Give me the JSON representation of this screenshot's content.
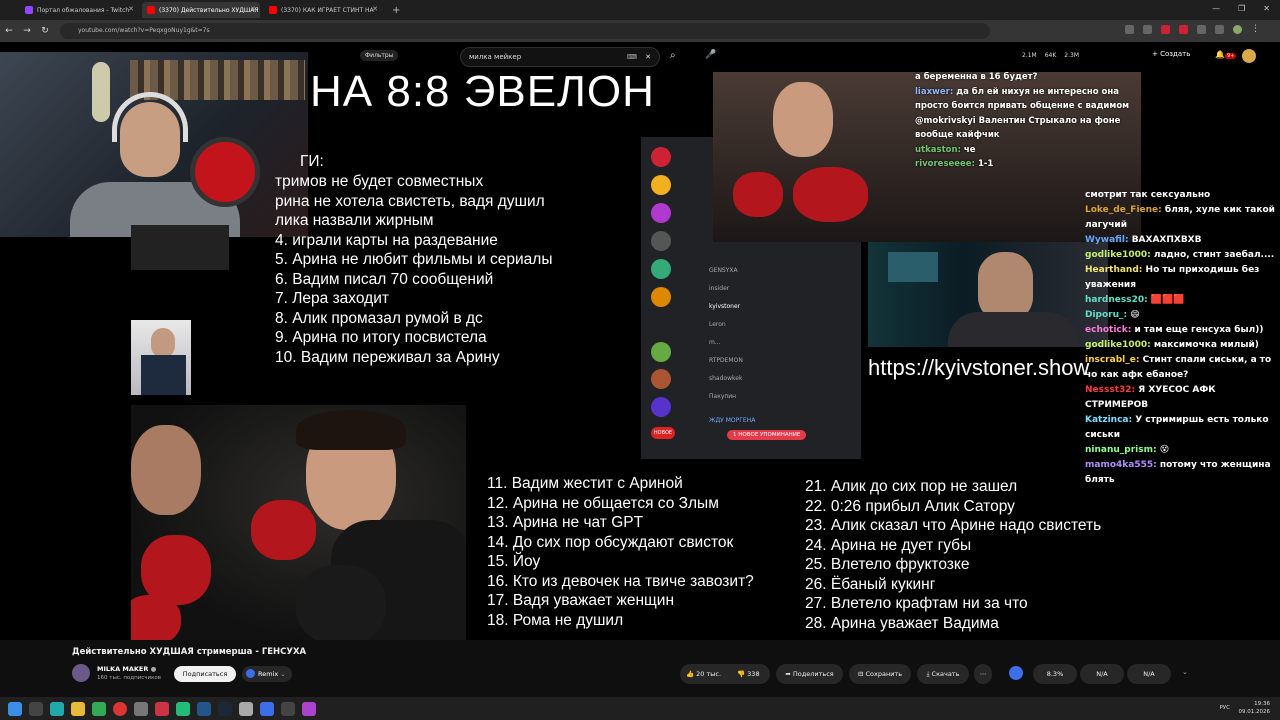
{
  "browser": {
    "tabs": [
      {
        "label": "Портал обжалования - Twitch",
        "color": "#9146ff",
        "active": false
      },
      {
        "label": "(3370) Действительно ХУДШАЯ",
        "color": "#ff0000",
        "active": true
      },
      {
        "label": "(3370) КАК ИГРАЕТ СТИНТ НА",
        "color": "#ff0000",
        "active": false
      }
    ],
    "url": "youtube.com/watch?v=PeqxgoNuy1g&t=7s"
  },
  "youtube_overlay": {
    "filter_label": "Фильтры",
    "search_value": "милка мейкер",
    "create_label": "Создать",
    "notif_badge": "9+",
    "top_stats": [
      "2.1M",
      "64K",
      "2.3M"
    ]
  },
  "video": {
    "headline": "НА 8:8 ЭВЕЛОН",
    "list_header": "ГИ:",
    "list_col1": [
      "тримов не будет совместных",
      "рина не хотела свистеть, вадя душил",
      "лика назвали жирным",
      "4. играли карты на раздевание",
      "5. Арина не любит фильмы и сериалы",
      "6. Вадим писал 70 сообщений",
      "7. Лера заходит",
      "8. Алик промазал румой в дс",
      "9. Арина по итогу посвистела",
      "10. Вадим переживал за Арину"
    ],
    "list_col2": [
      "11. Вадим жестит с Ариной",
      "12. Арина не общается со Злым",
      "13. Арина не чат GPT",
      "14. До сих пор обсуждают свисток",
      "15. Йоу",
      "16. Кто из девочек на твиче завозит?",
      "17. Вадя уважает женщин",
      "18. Рома не душил"
    ],
    "list_col3": [
      "21. Алик до сих пор не зашел",
      "22. 0:26 прибыл Алик Сатору",
      "23. Алик сказал что Арине надо свистеть",
      "24. Арина не дует губы",
      "25. Влетело фруктозке",
      "26. Ёбаный кукинг",
      "27. Влетело крафтам ни за что",
      "28. Арина уважает Вадима"
    ],
    "stream_url": "https://kyivstoner.show",
    "discord": {
      "members": [
        "GENSYXA",
        "insider",
        "kyivstoner",
        "Leron",
        "m...",
        "RTPDEMON",
        "shadowkek",
        "Пакупин",
        "ЖДУ МОРГЕНА"
      ],
      "notification": "1 НОВОЕ УПОМИНАНИЕ",
      "new_label": "НОВОЕ"
    },
    "top_chat": [
      {
        "user": "",
        "text": "а беременна в 16 будет?",
        "color": "#e36b6b"
      },
      {
        "user": "liaxwer:",
        "text": "да бл ей нихуя не интересно она просто боится привать общение с вадимом",
        "color": "#8fb7ff"
      },
      {
        "user": "",
        "text": "@mokrivskyi Валентин Стрыкало на фоне вообще кайфчик",
        "color": "#e36b6b"
      },
      {
        "user": "utkaston:",
        "text": "че",
        "color": "#6fc46f"
      },
      {
        "user": "rivoreseeee:",
        "text": "1-1",
        "color": "#6fc46f"
      }
    ],
    "chat": [
      {
        "user": "",
        "text": "смотрит так сексуально",
        "color": "#ffffff"
      },
      {
        "user": "Loke_de_Fiene:",
        "text": "бляя, хуле кик такой лагучий",
        "color": "#d8a330"
      },
      {
        "user": "Wywafil:",
        "text": "ВАХАХПХВХВ",
        "color": "#5fa8ff"
      },
      {
        "user": "godlike1000:",
        "text": "ладно, стинт заебал....",
        "color": "#c6f06e"
      },
      {
        "user": "Hearthand:",
        "text": "Но ты приходишь без уважения",
        "color": "#f0e36e"
      },
      {
        "user": "hardness20:",
        "text": "🟥🟥🟥",
        "color": "#5ee0c8"
      },
      {
        "user": "Diporu_:",
        "text": "😄",
        "color": "#5ee0c8"
      },
      {
        "user": "echotick:",
        "text": "и там еще генсуха был))",
        "color": "#ff7ad9"
      },
      {
        "user": "godlike1000:",
        "text": "максимочка милый)",
        "color": "#c6f06e"
      },
      {
        "user": "inscrabl_e:",
        "text": "Стинт спали сиськи, а то чо как афк ебаное?",
        "color": "#ffd23f"
      },
      {
        "user": "Nessst32:",
        "text": "Я ХУЕСОС АФК СТРИМЕРОВ",
        "color": "#ff3b3b"
      },
      {
        "user": "Katzinca:",
        "text": "У стримиршь есть только сиськи",
        "color": "#7ae0ff"
      },
      {
        "user": "ninanu_prism:",
        "text": "😵",
        "color": "#8fff8f"
      },
      {
        "user": "mamo4ka555:",
        "text": "потому что женщина блять",
        "color": "#b48cff"
      }
    ]
  },
  "below": {
    "title": "Действительно ХУДШАЯ стримерша - ГЕНСУХА",
    "channel": "MILKA MAKER",
    "subscribers": "160 тыс. подписчиков",
    "subscribe": "Подписаться",
    "remix": "Remix",
    "likes": "20 тыс.",
    "dislikes": "338",
    "share": "Поделиться",
    "save": "Сохранить",
    "download": "Скачать",
    "ext_stats": [
      "8.3%",
      "N/A",
      "N/A"
    ]
  },
  "taskbar": {
    "lang": "РУС",
    "time": "19:36",
    "date": "09.01.2026"
  }
}
